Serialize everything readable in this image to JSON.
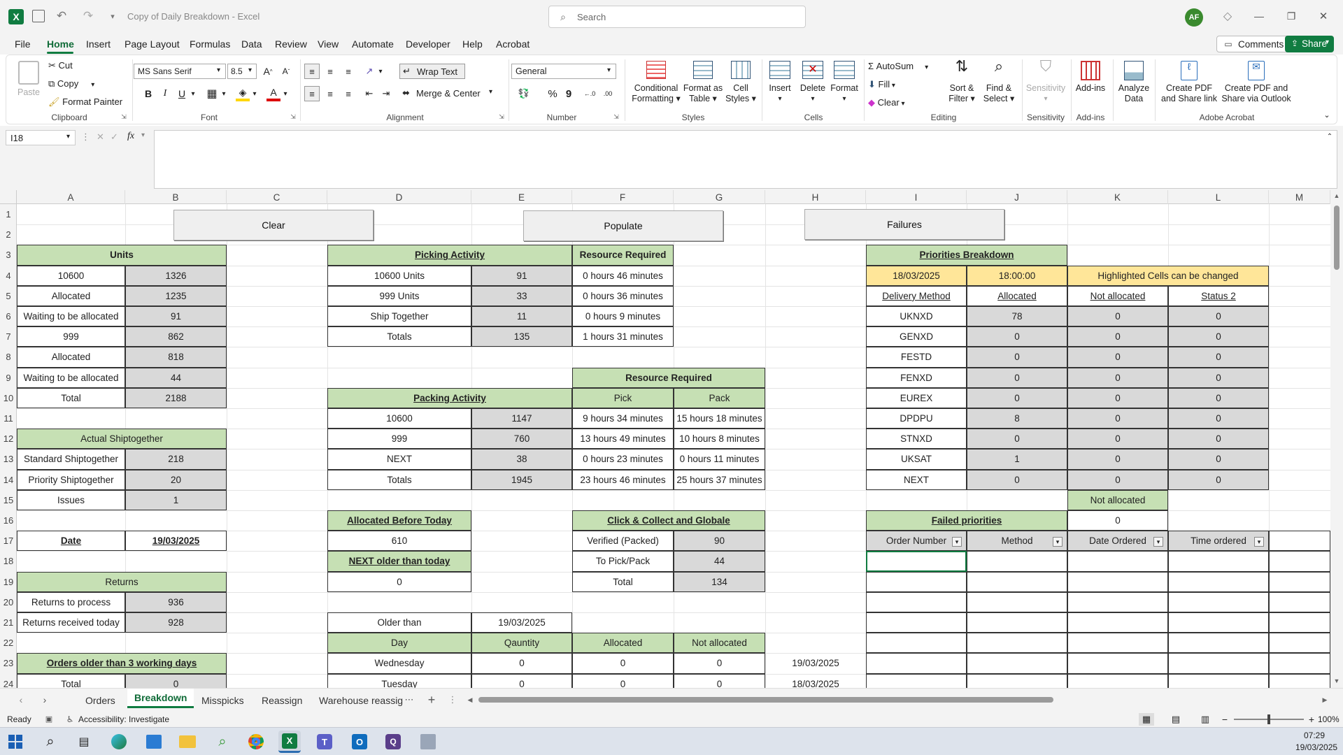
{
  "titlebar": {
    "title": "Copy of Daily Breakdown  -  Excel",
    "search_placeholder": "Search",
    "avatar": "AF"
  },
  "menu": {
    "tabs": [
      "File",
      "Home",
      "Insert",
      "Page Layout",
      "Formulas",
      "Data",
      "Review",
      "View",
      "Automate",
      "Developer",
      "Help",
      "Acrobat"
    ],
    "comments": "Comments",
    "share": "Share"
  },
  "ribbon": {
    "clipboard": {
      "paste": "Paste",
      "cut": "Cut",
      "copy": "Copy",
      "format_painter": "Format Painter",
      "group": "Clipboard"
    },
    "font": {
      "name": "MS Sans Serif",
      "size": "8.5",
      "group": "Font"
    },
    "alignment": {
      "wrap": "Wrap Text",
      "merge": "Merge & Center",
      "group": "Alignment"
    },
    "number": {
      "format": "General",
      "group": "Number"
    },
    "styles": {
      "cond1": "Conditional",
      "cond2": "Formatting",
      "fmt1": "Format as",
      "fmt2": "Table",
      "cell1": "Cell",
      "cell2": "Styles",
      "group": "Styles"
    },
    "cells": {
      "insert": "Insert",
      "delete": "Delete",
      "format": "Format",
      "group": "Cells"
    },
    "editing": {
      "autosum": "AutoSum",
      "fill": "Fill",
      "clear": "Clear",
      "sort1": "Sort &",
      "sort2": "Filter",
      "find1": "Find &",
      "find2": "Select",
      "group": "Editing"
    },
    "sensitivity": {
      "label": "Sensitivity",
      "group": "Sensitivity"
    },
    "addins": {
      "label": "Add-ins",
      "group": "Add-ins"
    },
    "analyze": {
      "l1": "Analyze",
      "l2": "Data"
    },
    "acrobat": {
      "a1": "Create PDF",
      "a2": "and Share link",
      "b1": "Create PDF and",
      "b2": "Share via Outlook",
      "group": "Adobe Acrobat"
    }
  },
  "formula_bar": {
    "name_box": "I18",
    "fx": "fx",
    "value": ""
  },
  "columns": [
    "A",
    "B",
    "C",
    "D",
    "E",
    "F",
    "G",
    "H",
    "I",
    "J",
    "K",
    "L",
    "M"
  ],
  "rows": [
    "1",
    "2",
    "3",
    "4",
    "5",
    "6",
    "7",
    "8",
    "9",
    "10",
    "11",
    "12",
    "13",
    "14",
    "15",
    "16",
    "17",
    "18",
    "19",
    "20",
    "21",
    "22",
    "23",
    "24"
  ],
  "buttons": {
    "clear": "Clear",
    "populate": "Populate",
    "failures": "Failures"
  },
  "units": {
    "header": "Units",
    "rows": [
      [
        "10600",
        "1326"
      ],
      [
        "Allocated",
        "1235"
      ],
      [
        "Waiting to be allocated",
        "91"
      ],
      [
        "999",
        "862"
      ],
      [
        "Allocated",
        "818"
      ],
      [
        "Waiting to be allocated",
        "44"
      ],
      [
        "Total",
        "2188"
      ]
    ]
  },
  "shiptogether": {
    "header": "Actual Shiptogether",
    "rows": [
      [
        "Standard Shiptogether",
        "218"
      ],
      [
        "Priority Shiptogether",
        "20"
      ],
      [
        "Issues",
        "1"
      ]
    ]
  },
  "date": {
    "label": "Date",
    "value": "19/03/2025"
  },
  "returns": {
    "header": "Returns",
    "rows": [
      [
        "Returns to process",
        "936"
      ],
      [
        "Returns received today",
        "928"
      ]
    ]
  },
  "older3": {
    "header": "Orders older than 3 working days",
    "rows": [
      [
        "Total",
        "0"
      ]
    ]
  },
  "picking": {
    "header": "Picking Activity",
    "resource_header": "Resource Required",
    "rows": [
      [
        "10600 Units",
        "91",
        "0 hours 46 minutes"
      ],
      [
        "999 Units",
        "33",
        "0 hours 36 minutes"
      ],
      [
        "Ship Together",
        "11",
        "0 hours 9 minutes"
      ],
      [
        "Totals",
        "135",
        "1 hours 31 minutes"
      ]
    ]
  },
  "packing": {
    "header": "Packing Activity",
    "resource_header": "Resource Required",
    "pick": "Pick",
    "pack": "Pack",
    "rows": [
      [
        "10600",
        "1147",
        "9 hours 34 minutes",
        "15 hours 18 minutes"
      ],
      [
        "999",
        "760",
        "13 hours 49 minutes",
        "10 hours 8 minutes"
      ],
      [
        "NEXT",
        "38",
        "0 hours 23 minutes",
        "0 hours 11 minutes"
      ],
      [
        "Totals",
        "1945",
        "23 hours 46 minutes",
        "25 hours 37 minutes"
      ]
    ]
  },
  "alloc_before": {
    "header": "Allocated Before Today",
    "value": "610"
  },
  "next_older": {
    "header": "NEXT older than today",
    "value": "0"
  },
  "click_collect": {
    "header": "Click & Collect and Globale",
    "rows": [
      [
        "Verified (Packed)",
        "90"
      ],
      [
        "To Pick/Pack",
        "44"
      ],
      [
        "Total",
        "134"
      ]
    ]
  },
  "older_than": {
    "label": "Older than",
    "value": "19/03/2025",
    "headers": [
      "Day",
      "Qauntity",
      "Allocated",
      "Not allocated"
    ],
    "rows": [
      [
        "Wednesday",
        "0",
        "0",
        "0",
        "19/03/2025"
      ],
      [
        "Tuesday",
        "0",
        "0",
        "0",
        "18/03/2025"
      ]
    ]
  },
  "priorities": {
    "header": "Priorities Breakdown",
    "date": "18/03/2025",
    "time": "18:00:00",
    "note": "Highlighted Cells can be changed",
    "headers": [
      "Delivery Method",
      "Allocated",
      "Not allocated",
      "Status 2"
    ],
    "rows": [
      [
        "UKNXD",
        "78",
        "0",
        "0"
      ],
      [
        "GENXD",
        "0",
        "0",
        "0"
      ],
      [
        "FESTD",
        "0",
        "0",
        "0"
      ],
      [
        "FENXD",
        "0",
        "0",
        "0"
      ],
      [
        "EUREX",
        "0",
        "0",
        "0"
      ],
      [
        "DPDPU",
        "8",
        "0",
        "0"
      ],
      [
        "STNXD",
        "0",
        "0",
        "0"
      ],
      [
        "UKSAT",
        "1",
        "0",
        "0"
      ],
      [
        "NEXT",
        "0",
        "0",
        "0"
      ]
    ]
  },
  "not_alloc": {
    "label": "Not allocated",
    "value": "0"
  },
  "failed": {
    "header": "Failed priorities",
    "headers": [
      "Order Number",
      "Method",
      "Date Ordered",
      "Time ordered"
    ]
  },
  "sheets": {
    "tabs": [
      "Orders",
      "Breakdown",
      "Misspicks",
      "Reassign",
      "Warehouse reassig"
    ],
    "active": "Breakdown"
  },
  "status": {
    "ready": "Ready",
    "accessibility": "Accessibility: Investigate",
    "zoom": "100%"
  },
  "taskbar": {
    "time": "07:29",
    "date": "19/03/2025"
  },
  "colors": {
    "excel_green": "#107c41",
    "header_green": "#c6e0b4",
    "value_grey": "#d9d9d9",
    "highlight_yellow": "#ffe699"
  }
}
